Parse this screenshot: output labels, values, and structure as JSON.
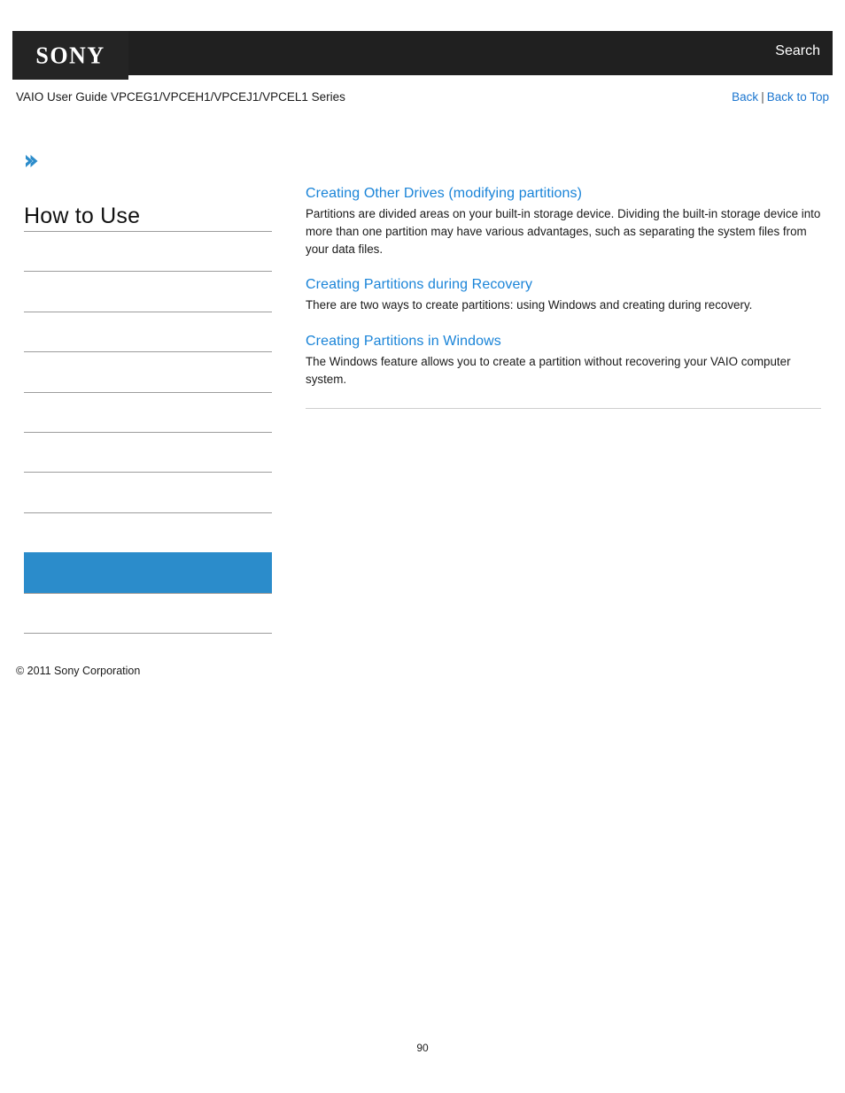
{
  "header": {
    "logo_text": "SONY",
    "search_label": "Search"
  },
  "subheader": {
    "guide_title": "VAIO User Guide VPCEG1/VPCEH1/VPCEJ1/VPCEL1 Series",
    "back_label": "Back",
    "separator": "|",
    "back_to_top_label": "Back to Top"
  },
  "sidebar": {
    "breadcrumb_icon": "chevron-right-icon",
    "title": "How to Use",
    "items": [
      {
        "label": "",
        "selected": false
      },
      {
        "label": "",
        "selected": false
      },
      {
        "label": "",
        "selected": false
      },
      {
        "label": "",
        "selected": false
      },
      {
        "label": "",
        "selected": false
      },
      {
        "label": "",
        "selected": false
      },
      {
        "label": "",
        "selected": false
      },
      {
        "label": "",
        "selected": false
      },
      {
        "label": "",
        "selected": true
      },
      {
        "label": "",
        "selected": false
      }
    ],
    "copyright": "© 2011 Sony Corporation"
  },
  "main": {
    "sections": [
      {
        "heading": "Creating Other Drives (modifying partitions)",
        "body": "Partitions are divided areas on your built-in storage device. Dividing the built-in storage device into more than one partition may have various advantages, such as separating the system files from your data files."
      },
      {
        "heading": "Creating Partitions during Recovery",
        "body": "There are two ways to create partitions: using Windows and creating during recovery."
      },
      {
        "heading": "Creating Partitions in Windows",
        "body": "The Windows feature allows you to create a partition without recovering your VAIO computer system."
      }
    ]
  },
  "footer": {
    "page_number": "90"
  },
  "colors": {
    "accent_blue": "#2b8ccb",
    "link_blue": "#1a84d8",
    "nav_link_blue": "#1a75cf",
    "header_black": "#202020",
    "logo_black": "#242424",
    "rule_gray": "#9c9c9c",
    "content_rule_gray": "#cfcfcf"
  }
}
